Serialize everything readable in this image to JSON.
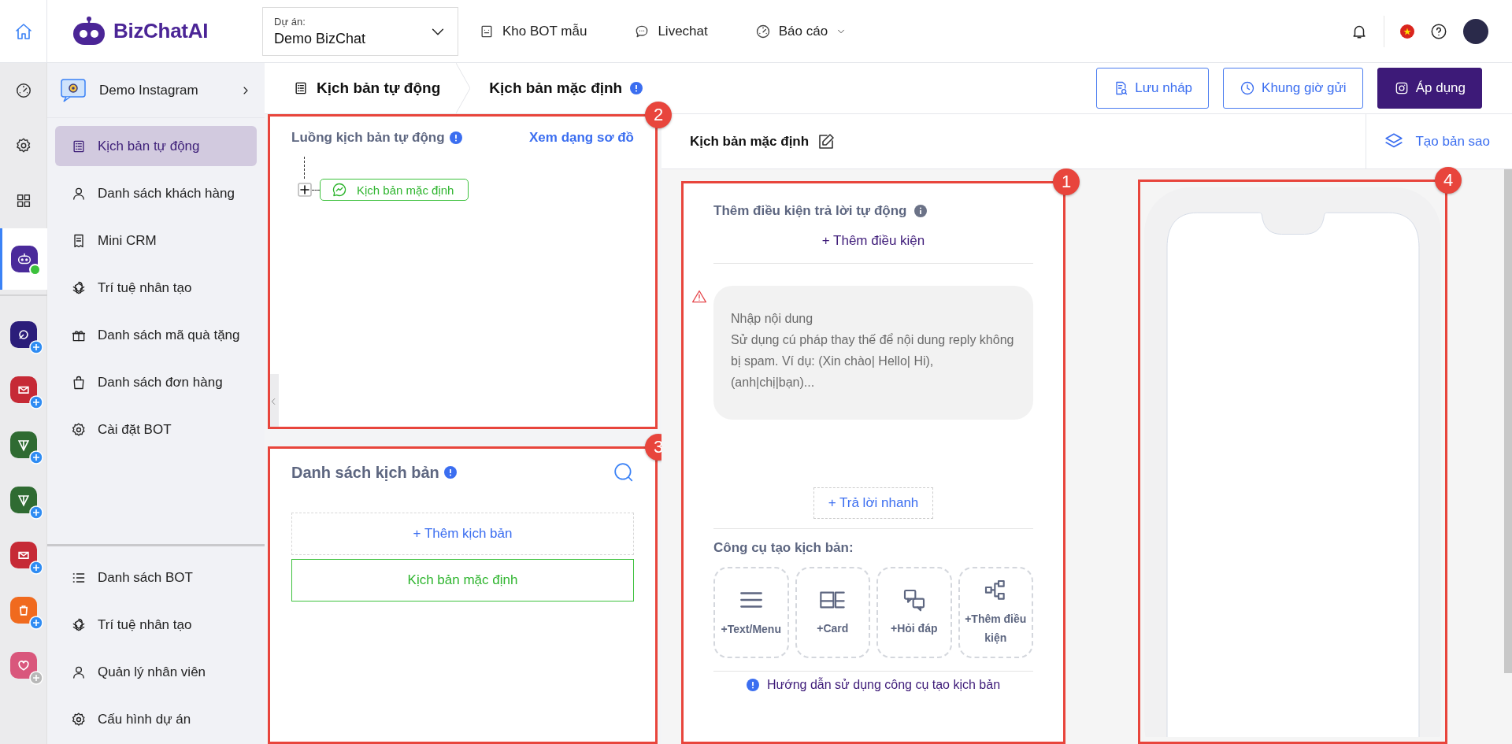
{
  "top_bar": {
    "logo": "BizChatAI",
    "project": {
      "label": "Dự án:",
      "value": "Demo BizChat"
    },
    "nav": [
      {
        "label": "Kho BOT mẫu",
        "kind": "bot",
        "dropdown": false
      },
      {
        "label": "Livechat",
        "kind": "chat",
        "dropdown": false
      },
      {
        "label": "Báo cáo",
        "kind": "gauge",
        "dropdown": true
      }
    ]
  },
  "rail": {
    "items": [
      {
        "kind": "gauge",
        "selected": false
      },
      {
        "kind": "gear",
        "selected": false
      },
      {
        "kind": "grid",
        "selected": false
      },
      {
        "kind": "bot",
        "selected": true,
        "online": true
      }
    ],
    "apps": [
      {
        "color": "#2b1d7a",
        "kind": "rocket",
        "badge_active": true
      },
      {
        "color": "#c62a36",
        "kind": "mail",
        "badge_active": true
      },
      {
        "color": "#2f6b32",
        "kind": "plane",
        "badge_active": true
      },
      {
        "color": "#2f6b32",
        "kind": "plane",
        "badge_active": true
      },
      {
        "color": "#c62a36",
        "kind": "mail",
        "badge_active": true
      },
      {
        "color": "#f06a1e",
        "kind": "bag",
        "badge_active": true
      },
      {
        "color": "#d9577c",
        "kind": "heart",
        "badge_active": false
      }
    ]
  },
  "sidebar": {
    "header": "Demo Instagram",
    "items": [
      {
        "label": "Kịch bản tự động",
        "kind": "list",
        "selected": true
      },
      {
        "label": "Danh sách khách hàng",
        "kind": "user",
        "selected": false
      },
      {
        "label": "Mini CRM",
        "kind": "receipt",
        "selected": false
      },
      {
        "label": "Trí tuệ nhân tạo",
        "kind": "ai",
        "selected": false
      },
      {
        "label": "Danh sách mã quà tặng",
        "kind": "gift",
        "selected": false
      },
      {
        "label": "Danh sách đơn hàng",
        "kind": "bag",
        "selected": false
      },
      {
        "label": "Cài đặt BOT",
        "kind": "gear",
        "selected": false
      }
    ],
    "bottom_items": [
      {
        "label": "Danh sách BOT",
        "kind": "bullets",
        "selected": false
      },
      {
        "label": "Trí tuệ nhân tạo",
        "kind": "ai",
        "selected": false
      },
      {
        "label": "Quản lý nhân viên",
        "kind": "user",
        "selected": false
      },
      {
        "label": "Cấu hình dự án",
        "kind": "gear",
        "selected": false
      }
    ]
  },
  "breadcrumb": [
    "Kịch bản tự động",
    "Kịch bản mặc định"
  ],
  "actions": [
    {
      "label": "Lưu nháp",
      "kind": "draft"
    },
    {
      "label": "Khung giờ gửi",
      "kind": "clock"
    },
    {
      "label": "Áp dụng",
      "kind": "apply"
    }
  ],
  "flow_panel": {
    "annotation": "2",
    "title": "Luồng kịch bản tự động",
    "link": "Xem dạng sơ đồ",
    "nodes": [
      {
        "label": "Kịch bản mặc định"
      }
    ]
  },
  "script_list": {
    "annotation": "3",
    "title": "Danh sách kịch bản",
    "add": "+ Thêm kịch bản",
    "items": [
      {
        "label": "Kịch bản mặc định",
        "selected": true
      }
    ]
  },
  "editor": {
    "title": "Kịch bản mặc định",
    "copy": "Tạo bản sao",
    "annotation": "1",
    "condition_title": "Thêm điều kiện trả lời tự động",
    "add_condition": "+ Thêm điều kiện",
    "message": {
      "placeholder": "Nhập nội dung\nSử dụng cú pháp thay thế để nội dung reply không bị spam. Ví dụ: (Xin chào| Hello| Hi), (anh|chị|bạn)..."
    },
    "quick_reply": "+ Trả lời nhanh",
    "tools_title": "Công cụ tạo kịch bản:",
    "tools": [
      {
        "label": "+Text/Menu",
        "kind": "text"
      },
      {
        "label": "+Card",
        "kind": "card"
      },
      {
        "label": "+Hỏi đáp",
        "kind": "qa"
      },
      {
        "label": "+Thêm điều kiện",
        "kind": "flow"
      }
    ],
    "help": "Hướng dẫn sử dụng công cụ tạo kịch bản"
  },
  "preview": {
    "annotation": "4"
  }
}
